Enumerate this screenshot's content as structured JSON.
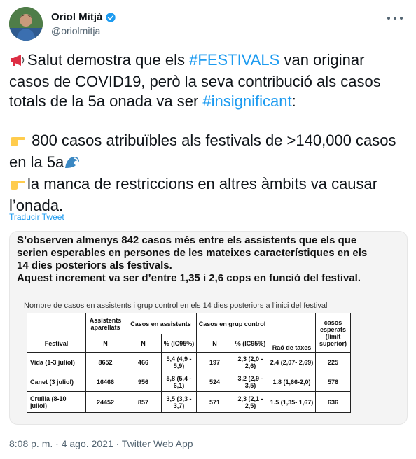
{
  "author": {
    "name": "Oriol Mitjà",
    "handle": "@oriolmitja",
    "verified": true
  },
  "icons": {
    "avatar": "avatar-photo",
    "verified": "verified-badge-icon",
    "more": "more-options-icon",
    "megaphone": "megaphone-emoji",
    "pointer": "backhand-index-pointing-right-emoji",
    "wave": "water-wave-emoji"
  },
  "colors": {
    "hashtag": "#1d9bf0",
    "text": "#0f1419",
    "secondary": "#536471"
  },
  "tweet": {
    "line1_pre": "Salut demostra que els ",
    "hashtag1": "#FESTIVALS",
    "line1_post": " van originar casos de COVID19, però la seva contribució als casos totals de la 5a onada va ser ",
    "hashtag2": "#insignificant",
    "line1_end": ":",
    "bullet1": " 800 casos atribuïbles als festivals de >140,000 casos en la 5a",
    "bullet2": "la manca de restriccions en altres àmbits va causar l’onada."
  },
  "translate_label": "Traducir Tweet",
  "media": {
    "heading_lines": [
      "S’observen almenys 842 casos més entre els assistents que els que",
      "serien esperables en persones de les mateixes característiques en els",
      "14 dies posteriors als festivals.",
      "Aquest increment va ser d’entre 1,35 i 2,6 cops en funció del festival."
    ],
    "caption": "Nombre de casos en assistents i grup control en els 14 dies posteriors a l’inici del festival",
    "table": {
      "h_assistents": "Assistents aparellats",
      "h_casos_assistents": "Casos en assistents",
      "h_casos_grup": "Casos en grup control",
      "h_rao": "Raó de taxes",
      "h_esperats": "casos esperats (limit superior)",
      "h_festival": "Festival",
      "h_n1": "N",
      "h_n2": "N",
      "h_pct1": "% (IC95%)",
      "h_n3": "N",
      "h_pct2": "% (IC95%)",
      "rows": [
        {
          "festival": "Vida (1-3 juliol)",
          "assistents": "8652",
          "n_cas": "466",
          "pct_cas": "5,4 (4,9 - 5,9)",
          "n_grup": "197",
          "pct_grup": "2,3 (2,0 - 2,6)",
          "rao": "2.4 (2,07- 2,69)",
          "esperats": "225"
        },
        {
          "festival": "Canet (3 juliol)",
          "assistents": "16466",
          "n_cas": "956",
          "pct_cas": "5,8 (5,4 - 6,1)",
          "n_grup": "524",
          "pct_grup": "3,2 (2,9 - 3,5)",
          "rao": "1.8 (1,66-2,0)",
          "esperats": "576"
        },
        {
          "festival": "Cruïlla (8-10 juliol)",
          "assistents": "24452",
          "n_cas": "857",
          "pct_cas": "3,5 (3,3 - 3,7)",
          "n_grup": "571",
          "pct_grup": "2,3 (2,1 - 2,5)",
          "rao": "1.5 (1,35- 1,67)",
          "esperats": "636"
        }
      ]
    }
  },
  "meta": {
    "time": "8:08 p. m.",
    "date": "4 ago. 2021",
    "source": "Twitter Web App",
    "separator": "·"
  }
}
